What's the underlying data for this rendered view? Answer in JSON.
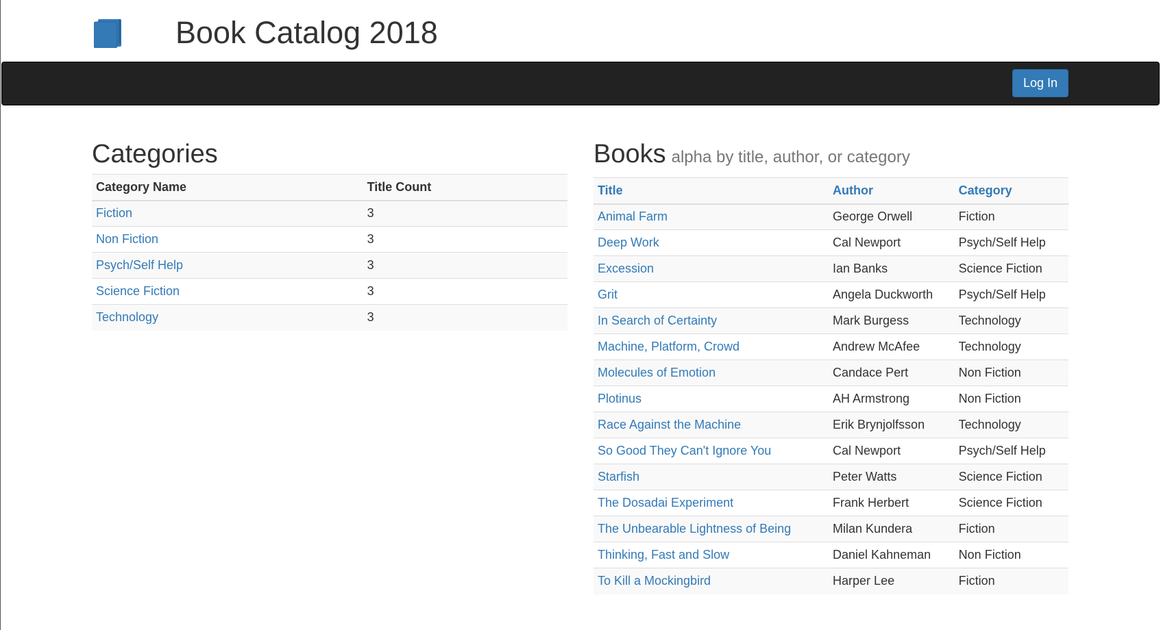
{
  "header": {
    "title": "Book Catalog 2018",
    "logo_icon": "book-icon",
    "accent_color": "#337ab7"
  },
  "navbar": {
    "login_label": "Log In"
  },
  "categories": {
    "heading": "Categories",
    "columns": [
      "Category Name",
      "Title Count"
    ],
    "rows": [
      {
        "name": "Fiction",
        "count": "3"
      },
      {
        "name": "Non Fiction",
        "count": "3"
      },
      {
        "name": "Psych/Self Help",
        "count": "3"
      },
      {
        "name": "Science Fiction",
        "count": "3"
      },
      {
        "name": "Technology",
        "count": "3"
      }
    ]
  },
  "books": {
    "heading": "Books",
    "subtitle": "alpha by title, author, or category",
    "columns": [
      "Title",
      "Author",
      "Category"
    ],
    "rows": [
      {
        "title": "Animal Farm",
        "author": "George Orwell",
        "category": "Fiction"
      },
      {
        "title": "Deep Work",
        "author": "Cal Newport",
        "category": "Psych/Self Help"
      },
      {
        "title": "Excession",
        "author": "Ian Banks",
        "category": "Science Fiction"
      },
      {
        "title": "Grit",
        "author": "Angela Duckworth",
        "category": "Psych/Self Help"
      },
      {
        "title": "In Search of Certainty",
        "author": "Mark Burgess",
        "category": "Technology"
      },
      {
        "title": "Machine, Platform, Crowd",
        "author": "Andrew McAfee",
        "category": "Technology"
      },
      {
        "title": "Molecules of Emotion",
        "author": "Candace Pert",
        "category": "Non Fiction"
      },
      {
        "title": "Plotinus",
        "author": "AH Armstrong",
        "category": "Non Fiction"
      },
      {
        "title": "Race Against the Machine",
        "author": "Erik Brynjolfsson",
        "category": "Technology"
      },
      {
        "title": "So Good They Can't Ignore You",
        "author": "Cal Newport",
        "category": "Psych/Self Help"
      },
      {
        "title": "Starfish",
        "author": "Peter Watts",
        "category": "Science Fiction"
      },
      {
        "title": "The Dosadai Experiment",
        "author": "Frank Herbert",
        "category": "Science Fiction"
      },
      {
        "title": "The Unbearable Lightness of Being",
        "author": "Milan Kundera",
        "category": "Fiction"
      },
      {
        "title": "Thinking, Fast and Slow",
        "author": "Daniel Kahneman",
        "category": "Non Fiction"
      },
      {
        "title": "To Kill a Mockingbird",
        "author": "Harper Lee",
        "category": "Fiction"
      }
    ]
  }
}
